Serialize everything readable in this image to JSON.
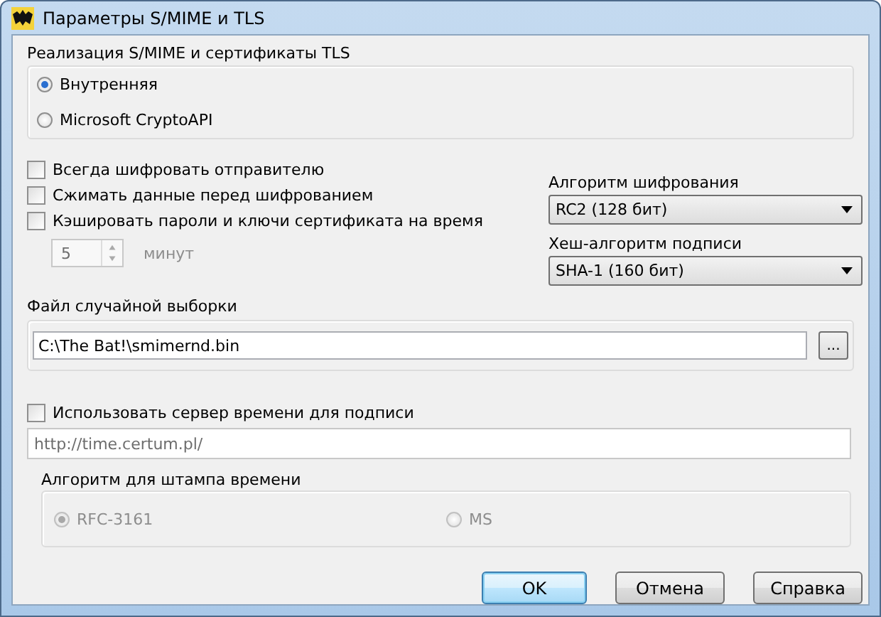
{
  "window": {
    "title": "Параметры S/MIME и TLS"
  },
  "implementation": {
    "title": "Реализация S/MIME и сертификаты TLS",
    "options": [
      {
        "label": "Внутренняя",
        "selected": true
      },
      {
        "label": "Microsoft CryptoAPI",
        "selected": false
      }
    ]
  },
  "options": [
    {
      "label": "Всегда шифровать отправителю",
      "checked": false
    },
    {
      "label": "Сжимать данные перед шифрованием",
      "checked": false
    },
    {
      "label": "Кэшировать пароли и ключи сертификата на время",
      "checked": false
    }
  ],
  "cache_time": {
    "value": "5",
    "unit": "минут",
    "disabled": true
  },
  "cipher": {
    "label": "Алгоритм шифрования",
    "value": "RC2 (128 бит)"
  },
  "hash": {
    "label": "Хеш-алгоритм подписи",
    "value": "SHA-1 (160 бит)"
  },
  "random_file": {
    "title": "Файл случайной выборки",
    "value": "C:\\The Bat!\\smimernd.bin",
    "browse": "..."
  },
  "timestamp": {
    "label": "Использовать сервер времени для подписи",
    "checked": false,
    "url": "http://time.certum.pl/",
    "disabled": true,
    "algorithm": {
      "title": "Алгоритм для штампа времени",
      "options": [
        {
          "label": "RFC-3161",
          "selected": true
        },
        {
          "label": "MS",
          "selected": false
        }
      ]
    }
  },
  "buttons": [
    {
      "label": "OK",
      "default": true
    },
    {
      "label": "Отмена",
      "default": false
    },
    {
      "label": "Справка",
      "default": false
    }
  ]
}
